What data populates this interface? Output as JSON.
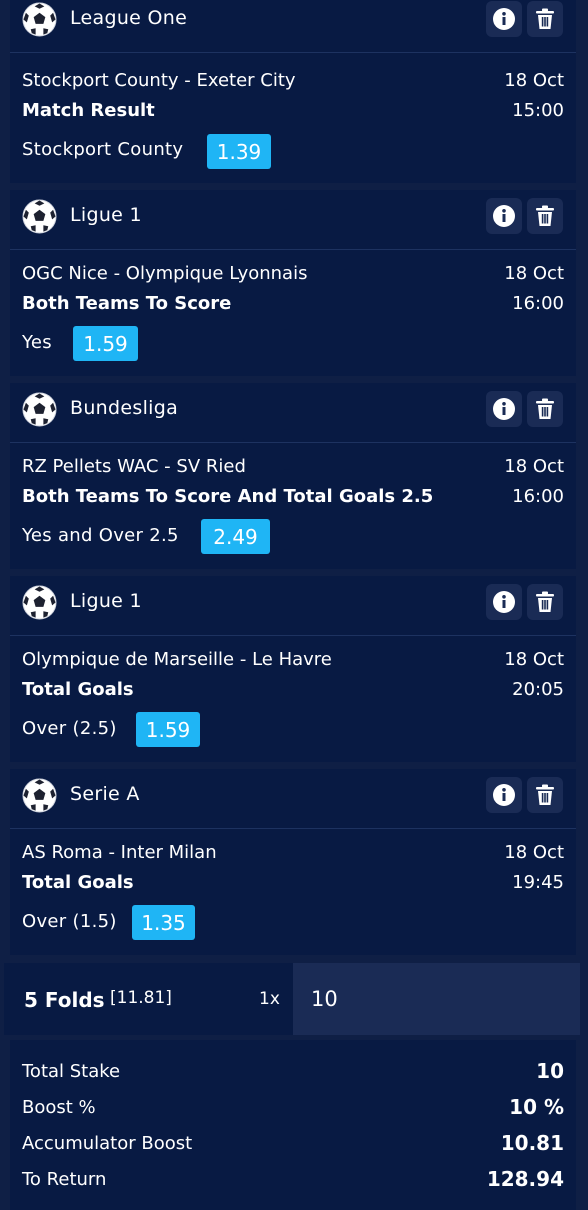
{
  "bets": [
    {
      "league": "League One",
      "match": "Stockport County - Exeter City",
      "date": "18 Oct",
      "market": "Match Result",
      "time": "15:00",
      "selection": "Stockport County",
      "odds": "1.39"
    },
    {
      "league": "Ligue 1",
      "match": "OGC Nice - Olympique Lyonnais",
      "date": "18 Oct",
      "market": "Both Teams To Score",
      "time": "16:00",
      "selection": "Yes",
      "odds": "1.59"
    },
    {
      "league": "Bundesliga",
      "match": "RZ Pellets WAC - SV Ried",
      "date": "18 Oct",
      "market": "Both Teams To Score And Total Goals 2.5",
      "time": "16:00",
      "selection": "Yes and Over 2.5",
      "odds": "2.49"
    },
    {
      "league": "Ligue 1",
      "match": "Olympique de Marseille - Le Havre",
      "date": "18 Oct",
      "market": "Total Goals",
      "time": "20:05",
      "selection": "Over (2.5)",
      "odds": "1.59"
    },
    {
      "league": "Serie A",
      "match": "AS Roma - Inter Milan",
      "date": "18 Oct",
      "market": "Total Goals",
      "time": "19:45",
      "selection": "Over (1.5)",
      "odds": "1.35"
    }
  ],
  "accumulator": {
    "title": "5 Folds",
    "combined_odds": "[11.81]",
    "multiplier": "1x",
    "stake_value": "10"
  },
  "summary": {
    "total_stake_label": "Total Stake",
    "total_stake": "10",
    "boost_label": "Boost %",
    "boost": "10 %",
    "acc_boost_label": "Accumulator Boost",
    "acc_boost": "10.81",
    "return_label": "To Return",
    "to_return": "128.94"
  },
  "colors": {
    "odds_bg": "#1fb5f5",
    "card_bg": "#081a43",
    "page_bg": "#0f1f45"
  },
  "icons": {
    "sport": "soccer-ball-icon",
    "info": "info-icon",
    "delete": "trash-icon"
  }
}
